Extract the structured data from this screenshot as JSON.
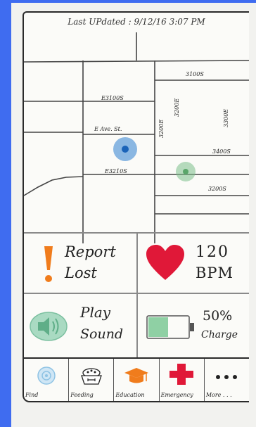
{
  "header": {
    "last_updated": "Last UPdated : 9/12/16 3:07 PM"
  },
  "map": {
    "street_labels": [
      "E3100S",
      "E Ave. St.",
      "E3210S",
      "3200E",
      "3300E",
      "3200E",
      "3200E",
      "3100S",
      "3200S"
    ],
    "street_labels_visible": [
      "E3100S",
      "E Ave. St.",
      "E3210S",
      "3200E",
      "3300E",
      "3400S",
      "3100S",
      "3200S"
    ],
    "markers": [
      {
        "name": "pet-location-marker",
        "color": "#2d7fd0"
      },
      {
        "name": "owner-location-marker",
        "color": "#7cc08a"
      }
    ]
  },
  "tiles": {
    "report_lost": {
      "line1": "Report",
      "line2": "Lost",
      "icon_color": "#f07c1c"
    },
    "heart_rate": {
      "value": "120",
      "unit": "BPM",
      "icon_color": "#e01838"
    },
    "play_sound": {
      "line1": "Play",
      "line2": "Sound",
      "icon_color": "#7cc0a0"
    },
    "battery": {
      "value": "50%",
      "label": "Charge",
      "icon_color": "#7cc0a0"
    }
  },
  "nav": [
    {
      "label": "Find",
      "icon": "target-icon"
    },
    {
      "label": "Feeding",
      "icon": "food-bowl-icon"
    },
    {
      "label": "Education",
      "icon": "graduation-cap-icon"
    },
    {
      "label": "Emergency",
      "icon": "red-cross-icon"
    },
    {
      "label": "More . . .",
      "icon": "more-dots-icon"
    }
  ],
  "colors": {
    "background": "#3f6cf0",
    "accent_orange": "#f07c1c",
    "heart_red": "#e01838",
    "green": "#7cc0a0"
  }
}
